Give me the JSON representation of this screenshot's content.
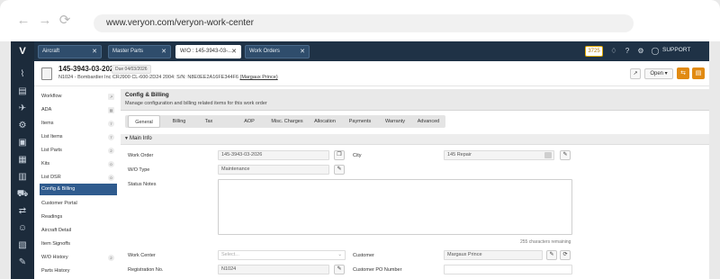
{
  "browser": {
    "url": "www.veryon.com/veryon-work-center",
    "back_icon": "arrow-left-icon",
    "forward_icon": "arrow-right-icon",
    "reload_icon": "reload-icon"
  },
  "top_tabs": [
    {
      "label": "Aircraft",
      "active": false
    },
    {
      "label": "Master Parts",
      "active": false
    },
    {
      "label": "W/O : 145-3943-03-...",
      "active": true
    },
    {
      "label": "Work Orders",
      "active": false
    }
  ],
  "topbar": {
    "badge": "3725",
    "support_label": "SUPPORT",
    "icons": [
      "bell-icon",
      "help-icon",
      "gear-icon",
      "user-icon"
    ]
  },
  "work_order": {
    "number": "145-3943-03-2026",
    "due": "Due 04/03/2026",
    "description": "N1024 - Bombardier Inc CRJ900 CL-600-2D24 2004: S/N: N8E0EE2A16FE344F6",
    "assignee": "(Margaux Prince)",
    "open_label": "Open"
  },
  "sidebar": {
    "items": [
      {
        "label": "Workflow",
        "count": ""
      },
      {
        "label": "ADA",
        "count": ""
      },
      {
        "label": "Items",
        "count": "7"
      },
      {
        "label": "List Items",
        "count": "7"
      },
      {
        "label": "List Parts",
        "count": "2"
      },
      {
        "label": "Kits",
        "count": "0"
      },
      {
        "label": "List DSR",
        "count": "0"
      },
      {
        "label": "Config & Billing",
        "count": ""
      },
      {
        "label": "Customer Portal",
        "count": ""
      },
      {
        "label": "Readings",
        "count": ""
      },
      {
        "label": "Aircraft Detail",
        "count": ""
      },
      {
        "label": "Item Signoffs",
        "count": ""
      },
      {
        "label": "W/O History",
        "count": "2"
      },
      {
        "label": "Parts History",
        "count": ""
      }
    ]
  },
  "section": {
    "title": "Config & Billing",
    "subtitle": "Manage configuration and billing related items for this work order"
  },
  "sub_tabs": [
    "General",
    "Billing",
    "Tax",
    "AOP",
    "Misc. Charges",
    "Allocation",
    "Payments",
    "Warranty",
    "Advanced"
  ],
  "main_info": {
    "label": "Main Info",
    "work_order_label": "Work Order",
    "work_order_value": "145-3943-03-2026",
    "city_label": "City",
    "city_value": "145 Repair",
    "wo_type_label": "W/O Type",
    "wo_type_value": "Maintenance",
    "status_notes_label": "Status Notes",
    "chars_remaining": "255 characters remaining",
    "work_center_label": "Work Center",
    "work_center_placeholder": "Select...",
    "customer_label": "Customer",
    "customer_value": "Margaux Prince",
    "registration_label": "Registration No.",
    "registration_value": "N1024",
    "customer_po_label": "Customer PO Number",
    "customer_po_value": ""
  }
}
